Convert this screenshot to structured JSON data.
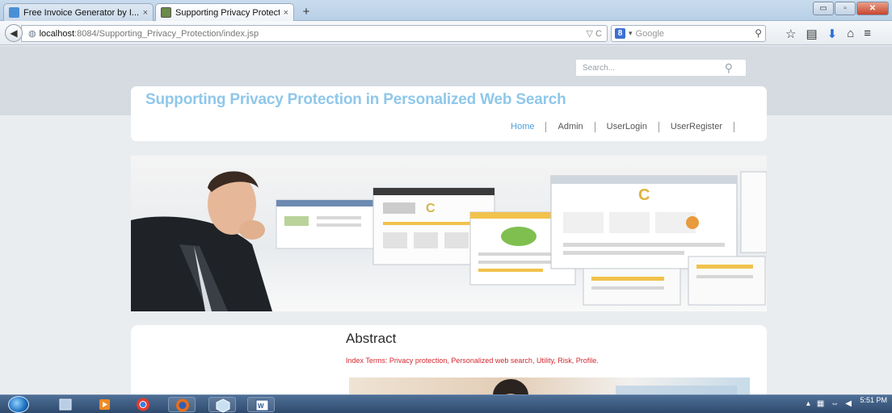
{
  "browser": {
    "tabs": [
      {
        "label": "Free Invoice Generator by I...",
        "close": "×"
      },
      {
        "label": "Supporting Privacy Protect...",
        "close": "×"
      }
    ],
    "new_tab": "+",
    "url_host": "localhost",
    "url_path": ":8084/Supporting_Privacy_Protection/index.jsp",
    "url_icons": "▽ C",
    "search_engine_badge": "8",
    "search_placeholder": "Google",
    "window_buttons": [
      "▭",
      "▫",
      "✕"
    ]
  },
  "site": {
    "search_placeholder": "Search...",
    "title": "Supporting Privacy Protection in Personalized Web Search",
    "nav": [
      "Home",
      "Admin",
      "UserLogin",
      "UserRegister"
    ]
  },
  "abstract": {
    "heading": "Abstract",
    "index_terms": "Index Terms: Privacy protection, Personalized web search, Utility, Risk, Profile."
  },
  "taskbar": {
    "time": "5:51 PM"
  },
  "colors": {
    "title_blue": "#8fc7ea",
    "nav_active": "#4aa0d8",
    "index_terms_red": "#d4272f"
  }
}
